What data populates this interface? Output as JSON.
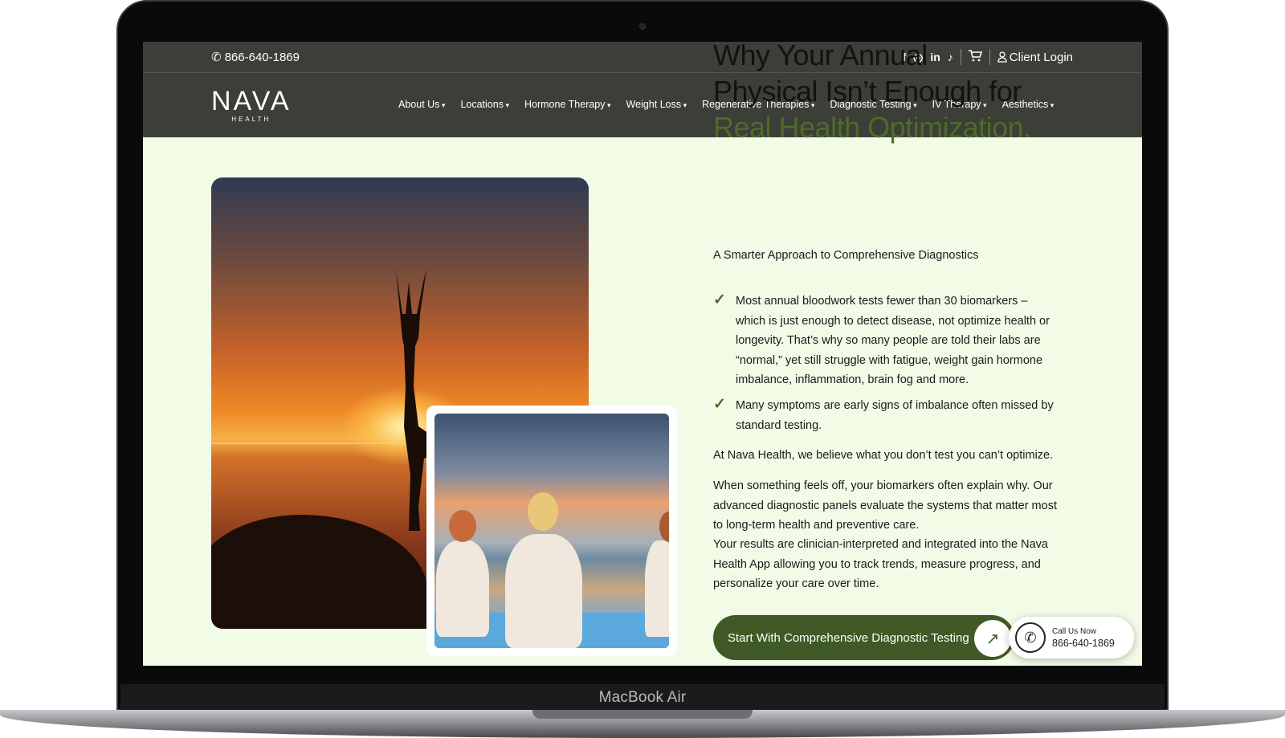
{
  "device": {
    "label": "MacBook Air"
  },
  "topbar": {
    "phone": "866-640-1869",
    "social": [
      "f",
      "◎",
      "in",
      "♪"
    ],
    "client_login": "Client Login"
  },
  "logo": {
    "name": "NAVA",
    "sub": "HEALTH"
  },
  "nav": {
    "items": [
      "About Us",
      "Locations",
      "Hormone Therapy",
      "Weight Loss",
      "Regenerative Therapies",
      "Diagnostic Testing",
      "IV Therapy",
      "Aesthetics"
    ]
  },
  "hero": {
    "title_line1": "Why Your Annual",
    "title_line2": "Physical Isn’t Enough for",
    "title_accent": "Real Health Optimization.",
    "subtitle": "A Smarter Approach to Comprehensive Diagnostics",
    "bullets": [
      "Most annual bloodwork tests fewer than 30 biomarkers – which is just enough to detect disease, not optimize health or longevity. That’s why so many people are told their labs are “normal,” yet still struggle with fatigue, weight gain hormone imbalance, inflammation, brain fog and more.",
      "Many symptoms are early signs of imbalance often missed by standard testing."
    ],
    "para1": "At Nava Health, we believe what you don’t test you can’t optimize.",
    "para2": "When something feels off, your biomarkers often explain why. Our advanced diagnostic panels evaluate the systems that matter most to long-term health and preventive care.",
    "para3": "Your results are clinician-interpreted and integrated into the Nava Health App allowing you to track trends, measure progress, and personalize your care over time.",
    "cta": "Start With Comprehensive Diagnostic Testing"
  },
  "call_widget": {
    "label": "Call Us Now",
    "number": "866-640-1869"
  },
  "colors": {
    "nav_bg": "#3c3e38",
    "page_bg": "#f1fbe6",
    "accent": "#4e6b2a",
    "cta_bg": "#3f5a26"
  }
}
